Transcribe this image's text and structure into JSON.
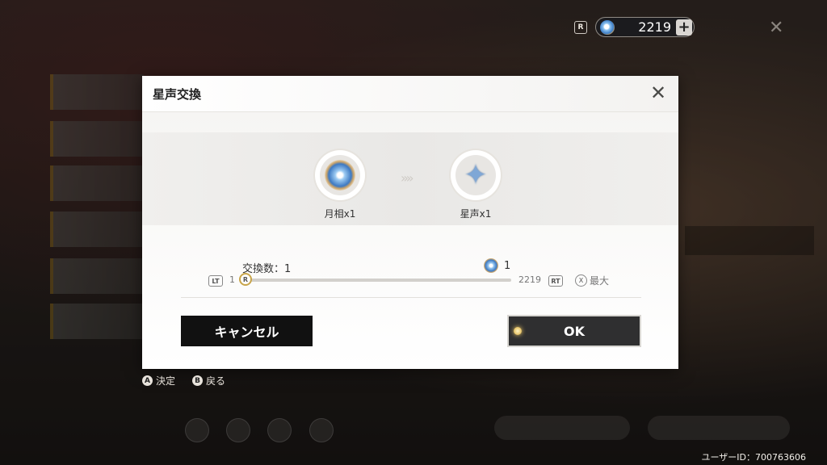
{
  "currency": {
    "badge": "R",
    "icon": "moon-phase-icon",
    "value": "2219",
    "plus": "+"
  },
  "dialog": {
    "title": "星声交換",
    "close": "✕",
    "from_item": {
      "icon": "moon-phase-icon",
      "label": "月相x1"
    },
    "to_item": {
      "icon": "star-voice-icon",
      "label": "星声x1"
    },
    "arrow": "»»",
    "quantity_label": "交換数：1",
    "cost_value": "1",
    "slider": {
      "lt": "LT",
      "min": "1",
      "thumb": "R",
      "max": "2219",
      "rt": "RT",
      "max_button": "X",
      "max_label": "最大",
      "value": 1,
      "range": [
        1,
        2219
      ]
    },
    "cancel": "キャンセル",
    "ok": "OK"
  },
  "hints": [
    {
      "button": "A",
      "label": "決定"
    },
    {
      "button": "B",
      "label": "戻る"
    }
  ],
  "user_id": "ユーザーID：700763606",
  "colors": {
    "accent": "#c8a54a",
    "cancel_bg": "#111111",
    "ok_bg": "#2f2f30"
  }
}
